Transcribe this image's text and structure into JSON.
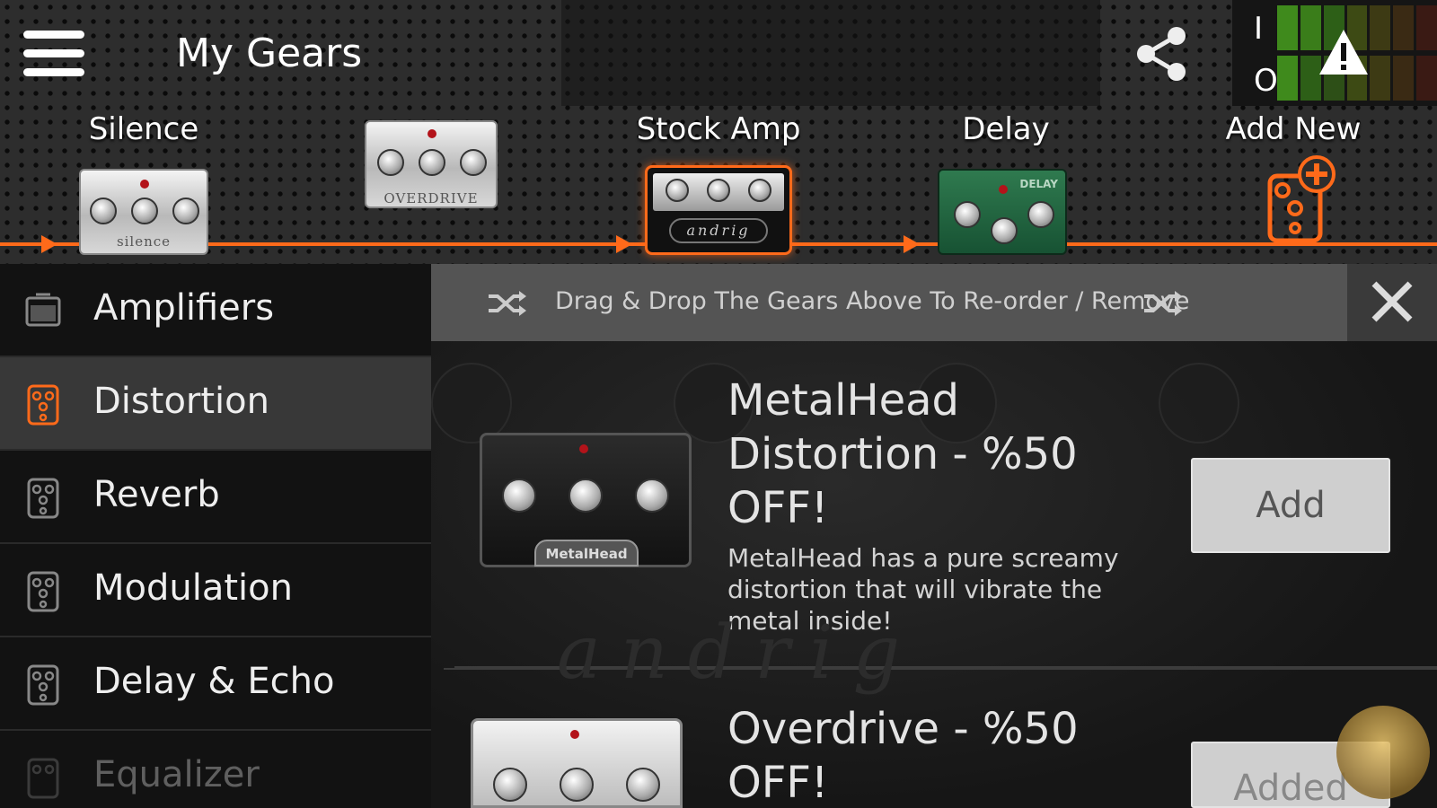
{
  "header": {
    "title": "My Gears",
    "meter": {
      "input_label": "I",
      "output_label": "O"
    }
  },
  "chain": [
    {
      "label": "Silence",
      "pedal_text": "silence"
    },
    {
      "label": "",
      "pedal_text": "OVERDRIVE"
    },
    {
      "label": "Stock Amp",
      "pedal_text": "andrig"
    },
    {
      "label": "Delay",
      "pedal_text": "DELAY"
    },
    {
      "label": "Add New"
    }
  ],
  "sidebar": {
    "items": [
      {
        "label": "Amplifiers",
        "icon": "amplifier-icon"
      },
      {
        "label": "Distortion",
        "icon": "pedal-icon",
        "active": true
      },
      {
        "label": "Reverb",
        "icon": "pedal-icon"
      },
      {
        "label": "Modulation",
        "icon": "pedal-icon"
      },
      {
        "label": "Delay & Echo",
        "icon": "pedal-icon"
      },
      {
        "label": "Equalizer",
        "icon": "pedal-icon"
      }
    ]
  },
  "hint": {
    "text": "Drag & Drop The Gears Above To Re-order / Remove"
  },
  "products": [
    {
      "title": "MetalHead Distortion - %50 OFF!",
      "description": "MetalHead has a pure screamy distortion that will vibrate the metal inside!",
      "pedal_text": "MetalHead",
      "button": "Add"
    },
    {
      "title": "Overdrive - %50 OFF!",
      "button": "Added"
    }
  ],
  "watermark": "andrig",
  "colors": {
    "accent": "#ff6a1a",
    "sidebar_active": "#383838",
    "hint_bar": "#545454"
  }
}
